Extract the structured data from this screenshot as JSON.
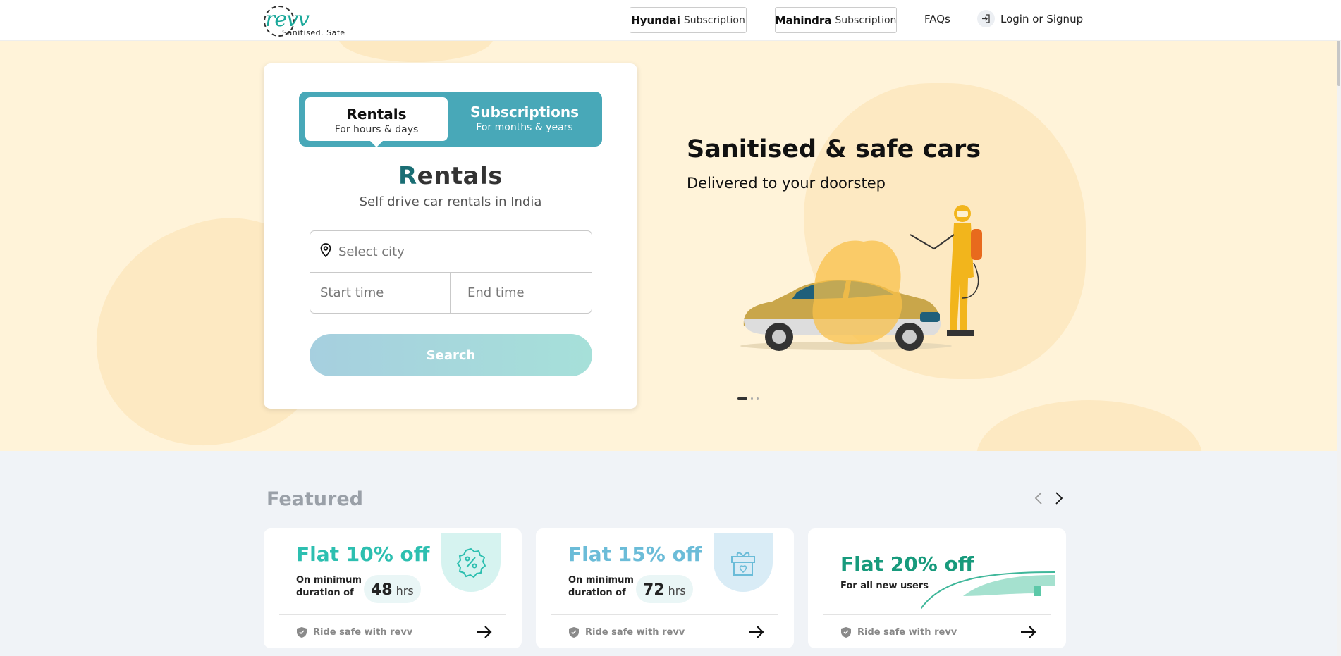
{
  "header": {
    "logo_word": "revv",
    "logo_tagline": "Sanitised. Safe",
    "subscriptions": [
      {
        "brand": "Hyundai",
        "suffix": "Subscription"
      },
      {
        "brand": "Mahindra",
        "suffix": "Subscription"
      }
    ],
    "faqs_label": "FAQs",
    "login_label": "Login or Signup"
  },
  "booking": {
    "tabs": [
      {
        "label": "Rentals",
        "sub": "For hours & days",
        "active": true
      },
      {
        "label": "Subscriptions",
        "sub": "For months & years",
        "active": false
      }
    ],
    "heading_first_letter": "R",
    "heading_rest": "entals",
    "subtitle": "Self drive car rentals in India",
    "city_placeholder": "Select city",
    "start_placeholder": "Start time",
    "end_placeholder": "End time",
    "search_label": "Search"
  },
  "hero": {
    "title": "Sanitised & safe cars",
    "subtitle": "Delivered to your doorstep",
    "slides_total": 3,
    "active_slide": 1
  },
  "featured": {
    "title": "Featured",
    "offers": [
      {
        "title": "Flat 10% off",
        "min_label": "On minimum duration of",
        "hours": "48",
        "unit": "hrs",
        "footer": "Ride safe with revv",
        "icon": "percent-badge-icon"
      },
      {
        "title": "Flat 15% off",
        "min_label": "On minimum duration of",
        "hours": "72",
        "unit": "hrs",
        "footer": "Ride safe with revv",
        "icon": "gift-icon"
      },
      {
        "title": "Flat 20% off",
        "subtitle": "For all new users",
        "footer": "Ride safe with revv",
        "icon": "road-swoosh-icon"
      }
    ]
  },
  "colors": {
    "brand_teal": "#1aa89a",
    "tab_bg": "#48a8b8",
    "hero_bg": "#fff3d9",
    "page_bg": "#f0f3f7"
  }
}
